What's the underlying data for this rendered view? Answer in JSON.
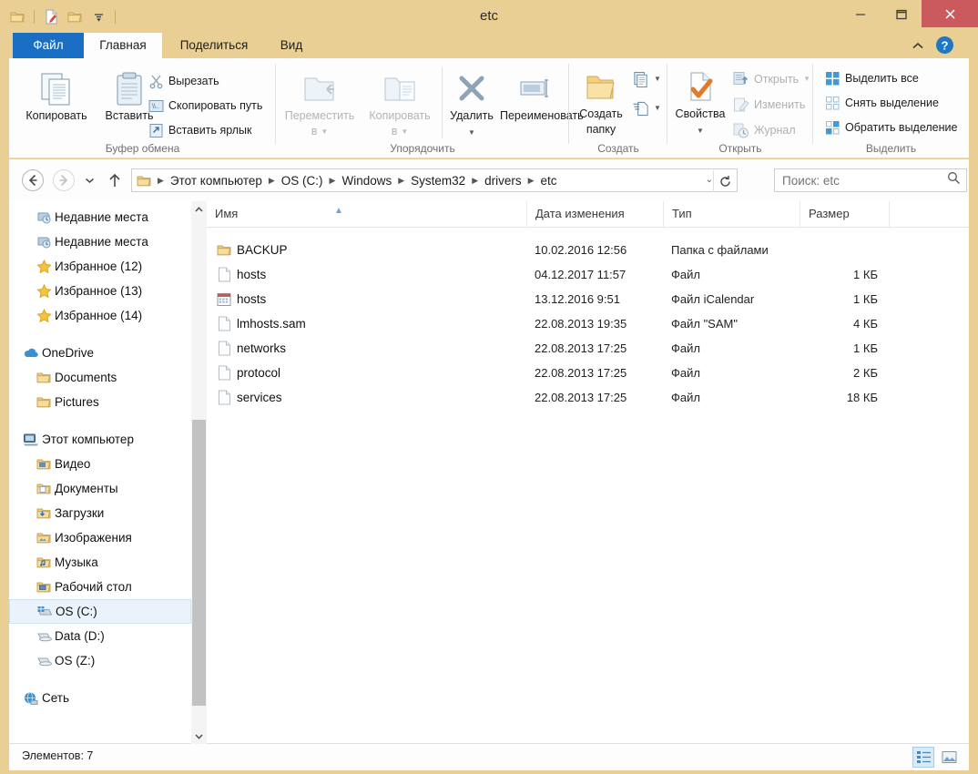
{
  "window": {
    "title": "etc",
    "minimize_label": "Свернуть",
    "maximize_label": "Развернуть",
    "close_label": "Закрыть",
    "titlebar_color": "#e9cf93",
    "close_color": "#cb5a5e"
  },
  "quick_access": [
    {
      "name": "folder-icon",
      "label": "Свойства папки"
    },
    {
      "name": "new-file-icon",
      "label": "Создать"
    },
    {
      "name": "folder-icon-2",
      "label": "Новая папка"
    },
    {
      "name": "chevron-down-icon",
      "label": "Настройка панели быстрого доступа"
    }
  ],
  "tabs": [
    {
      "label": "Файл",
      "active": false,
      "file_tab": true
    },
    {
      "label": "Главная",
      "active": true
    },
    {
      "label": "Поделиться",
      "active": false
    },
    {
      "label": "Вид",
      "active": false
    }
  ],
  "ribbon": {
    "collapse_label": "Свернуть ленту",
    "help_label": "Справка",
    "groups": [
      {
        "name": "clipboard",
        "label": "Буфер обмена",
        "big": [
          {
            "label": "Копировать",
            "icon": "copy-icon",
            "disabled": false
          },
          {
            "label": "Вставить",
            "icon": "paste-icon",
            "disabled": false
          }
        ],
        "small": [
          {
            "label": "Вырезать",
            "icon": "cut-icon",
            "disabled": false
          },
          {
            "label": "Скопировать путь",
            "icon": "copy-path-icon",
            "disabled": false
          },
          {
            "label": "Вставить ярлык",
            "icon": "paste-shortcut-icon",
            "disabled": false
          }
        ]
      },
      {
        "name": "organize",
        "label": "Упорядочить",
        "big": [
          {
            "label": "Переместить",
            "label2": "в",
            "icon": "move-to-icon",
            "disabled": true,
            "caret": true
          },
          {
            "label": "Копировать",
            "label2": "в",
            "icon": "copy-to-icon",
            "disabled": true,
            "caret": true
          },
          {
            "label": "Удалить",
            "icon": "delete-icon",
            "disabled": false,
            "caret": true
          },
          {
            "label": "Переименовать",
            "icon": "rename-icon",
            "disabled": false
          }
        ]
      },
      {
        "name": "new",
        "label": "Создать",
        "big": [
          {
            "label": "Создать",
            "label2": "папку",
            "icon": "new-folder-icon",
            "disabled": false
          }
        ],
        "small": [
          {
            "label": "",
            "icon": "new-item-icon",
            "caret": true
          },
          {
            "label": "",
            "icon": "easy-access-icon",
            "caret": true
          }
        ]
      },
      {
        "name": "open",
        "label": "Открыть",
        "big": [
          {
            "label": "Свойства",
            "icon": "properties-icon",
            "disabled": false,
            "caret": true
          }
        ],
        "small": [
          {
            "label": "Открыть",
            "icon": "open-icon",
            "disabled": true,
            "caret": true
          },
          {
            "label": "Изменить",
            "icon": "edit-icon",
            "disabled": true
          },
          {
            "label": "Журнал",
            "icon": "history-icon",
            "disabled": true
          }
        ]
      },
      {
        "name": "select",
        "label": "Выделить",
        "small": [
          {
            "label": "Выделить все",
            "icon": "select-all-icon",
            "disabled": false
          },
          {
            "label": "Снять выделение",
            "icon": "select-none-icon",
            "disabled": false
          },
          {
            "label": "Обратить выделение",
            "icon": "invert-selection-icon",
            "disabled": false
          }
        ]
      }
    ]
  },
  "address": {
    "back_label": "Назад",
    "forward_label": "Вперед",
    "recent_label": "Последние расположения",
    "up_label": "Вверх",
    "breadcrumbs": [
      "Этот компьютер",
      "OS (C:)",
      "Windows",
      "System32",
      "drivers",
      "etc"
    ],
    "dropdown_label": "Предыдущие папки",
    "refresh_label": "Обновить",
    "search_placeholder": "Поиск: etc",
    "search_value": ""
  },
  "navpane": {
    "groups": [
      {
        "items": [
          {
            "label": "Недавние места",
            "icon": "recent-places-icon",
            "indent": 1,
            "selected": false
          },
          {
            "label": "Недавние места",
            "icon": "recent-places-icon",
            "indent": 1,
            "selected": false
          },
          {
            "label": "Избранное (12)",
            "icon": "star-icon",
            "indent": 1,
            "selected": false
          },
          {
            "label": "Избранное (13)",
            "icon": "star-icon",
            "indent": 1,
            "selected": false
          },
          {
            "label": "Избранное (14)",
            "icon": "star-icon",
            "indent": 1,
            "selected": false
          }
        ]
      },
      {
        "items": [
          {
            "label": "OneDrive",
            "icon": "onedrive-icon",
            "indent": 0,
            "selected": false
          },
          {
            "label": "Documents",
            "icon": "folder-icon",
            "indent": 1,
            "selected": false
          },
          {
            "label": "Pictures",
            "icon": "folder-icon",
            "indent": 1,
            "selected": false
          }
        ]
      },
      {
        "items": [
          {
            "label": "Этот компьютер",
            "icon": "computer-icon",
            "indent": 0,
            "selected": false
          },
          {
            "label": "Видео",
            "icon": "video-folder-icon",
            "indent": 1,
            "selected": false
          },
          {
            "label": "Документы",
            "icon": "documents-folder-icon",
            "indent": 1,
            "selected": false
          },
          {
            "label": "Загрузки",
            "icon": "downloads-folder-icon",
            "indent": 1,
            "selected": false
          },
          {
            "label": "Изображения",
            "icon": "pictures-folder-icon",
            "indent": 1,
            "selected": false
          },
          {
            "label": "Музыка",
            "icon": "music-folder-icon",
            "indent": 1,
            "selected": false
          },
          {
            "label": "Рабочий стол",
            "icon": "desktop-folder-icon",
            "indent": 1,
            "selected": false
          },
          {
            "label": "OS (C:)",
            "icon": "system-drive-icon",
            "indent": 1,
            "selected": true
          },
          {
            "label": "Data (D:)",
            "icon": "drive-icon",
            "indent": 1,
            "selected": false
          },
          {
            "label": "OS (Z:)",
            "icon": "drive-icon",
            "indent": 1,
            "selected": false
          }
        ]
      },
      {
        "items": [
          {
            "label": "Сеть",
            "icon": "network-icon",
            "indent": 0,
            "selected": false
          }
        ]
      }
    ]
  },
  "filelist": {
    "columns": [
      {
        "label": "Имя",
        "sorted": "asc"
      },
      {
        "label": "Дата изменения"
      },
      {
        "label": "Тип"
      },
      {
        "label": "Размер"
      }
    ],
    "rows": [
      {
        "name": "BACKUP",
        "icon": "folder-icon",
        "date": "10.02.2016 12:56",
        "type": "Папка с файлами",
        "size": ""
      },
      {
        "name": "hosts",
        "icon": "file-icon",
        "date": "04.12.2017 11:57",
        "type": "Файл",
        "size": "1 КБ"
      },
      {
        "name": "hosts",
        "icon": "calendar-icon",
        "date": "13.12.2016 9:51",
        "type": "Файл iCalendar",
        "size": "1 КБ"
      },
      {
        "name": "lmhosts.sam",
        "icon": "file-icon",
        "date": "22.08.2013 19:35",
        "type": "Файл \"SAM\"",
        "size": "4 КБ"
      },
      {
        "name": "networks",
        "icon": "file-icon",
        "date": "22.08.2013 17:25",
        "type": "Файл",
        "size": "1 КБ"
      },
      {
        "name": "protocol",
        "icon": "file-icon",
        "date": "22.08.2013 17:25",
        "type": "Файл",
        "size": "2 КБ"
      },
      {
        "name": "services",
        "icon": "file-icon",
        "date": "22.08.2013 17:25",
        "type": "Файл",
        "size": "18 КБ"
      }
    ]
  },
  "statusbar": {
    "item_count_text": "Элементов: 7",
    "views": [
      {
        "name": "details-view-button",
        "label": "Таблица",
        "active": true
      },
      {
        "name": "large-icons-view-button",
        "label": "Крупные значки",
        "active": false
      }
    ]
  }
}
